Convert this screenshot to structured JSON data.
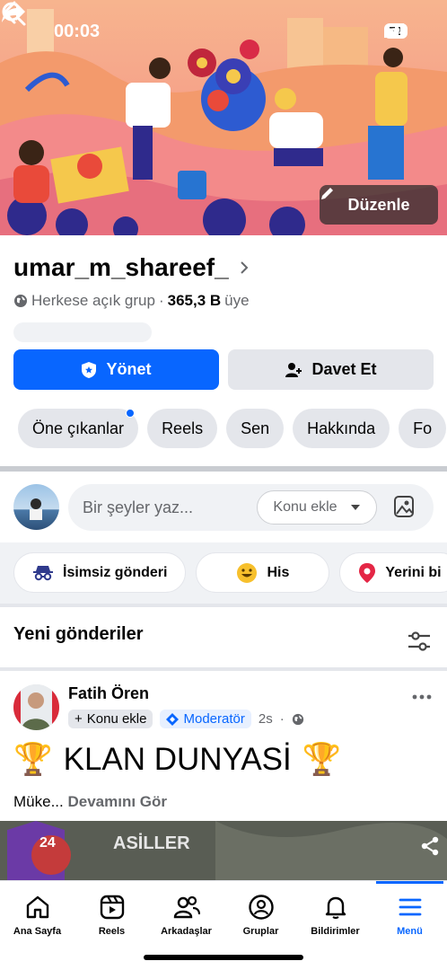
{
  "status_bar": {
    "time": "00:03",
    "battery": "72"
  },
  "cover": {
    "edit_label": "Düzenle"
  },
  "group": {
    "name": "umar_m_shareef_",
    "privacy": "Herkese açık grup",
    "separator": "·",
    "member_count": "365,3 B",
    "member_label": "üye",
    "manage_label": "Yönet",
    "invite_label": "Davet Et"
  },
  "tabs": [
    {
      "label": "Öne çıkanlar"
    },
    {
      "label": "Reels"
    },
    {
      "label": "Sen"
    },
    {
      "label": "Hakkında"
    },
    {
      "label": "Fo"
    }
  ],
  "composer": {
    "placeholder": "Bir şeyler yaz...",
    "topic_label": "Konu ekle"
  },
  "post_options": [
    {
      "label": "İsimsiz gönderi",
      "icon": "incognito-icon"
    },
    {
      "label": "His",
      "icon": "smiley-icon"
    },
    {
      "label": "Yerini bi",
      "icon": "location-pin-icon"
    }
  ],
  "feed": {
    "section_title": "Yeni gönderiler"
  },
  "post": {
    "author": "Fatih Ören",
    "topic_label": "Konu ekle",
    "role_label": "Moderatör",
    "time": "2s",
    "headline_emoji_left": "🏆",
    "headline": "KLAN DUNYASİ",
    "headline_emoji_right": "🏆",
    "body": "Müke...",
    "see_more": "Devamını Gör",
    "image_level": "24",
    "image_title": "ASİLLER"
  },
  "bottom_nav": [
    {
      "label": "Ana Sayfa",
      "icon": "home-icon"
    },
    {
      "label": "Reels",
      "icon": "reels-icon"
    },
    {
      "label": "Arkadaşlar",
      "icon": "friends-icon"
    },
    {
      "label": "Gruplar",
      "icon": "groups-icon"
    },
    {
      "label": "Bildirimler",
      "icon": "bell-icon"
    },
    {
      "label": "Menü",
      "icon": "menu-icon",
      "active": true
    }
  ],
  "colors": {
    "accent": "#0866ff",
    "chip_bg": "#e4e6eb",
    "muted_text": "#65676b"
  }
}
